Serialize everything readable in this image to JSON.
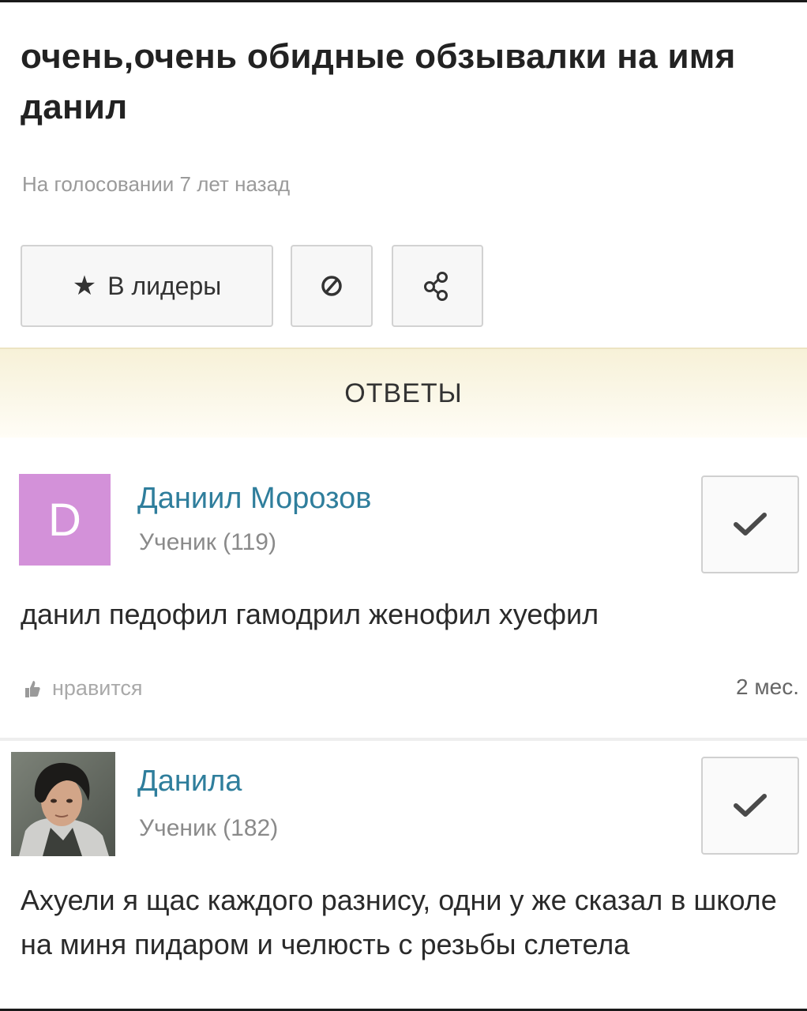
{
  "question": {
    "title": "очень,очень обидные обзывалки на имя данил",
    "meta": "На голосовании 7 лет назад"
  },
  "actions": {
    "leader_label": "В лидеры",
    "leader_icon": "star-icon",
    "block_icon": "block-icon",
    "share_icon": "share-icon"
  },
  "answers_header": "ОТВЕТЫ",
  "answers": [
    {
      "avatar_letter": "D",
      "avatar_color": "#d391d9",
      "author": "Даниил Морозов",
      "rank": "Ученик (119)",
      "text": "данил педофил гамодрил женофил хуефил",
      "like_label": "нравится",
      "time": "2 мес."
    },
    {
      "avatar_icon": "user-photo-avatar",
      "author": "Данила",
      "rank": "Ученик (182)",
      "text": "Ахуели я щас каждого разнису, одни у же сказал в школе на миня пидаром и челюсть с резьбы слетела"
    }
  ],
  "colors": {
    "author_link": "#2f7e9c",
    "header_band": "#f7f1d8"
  }
}
